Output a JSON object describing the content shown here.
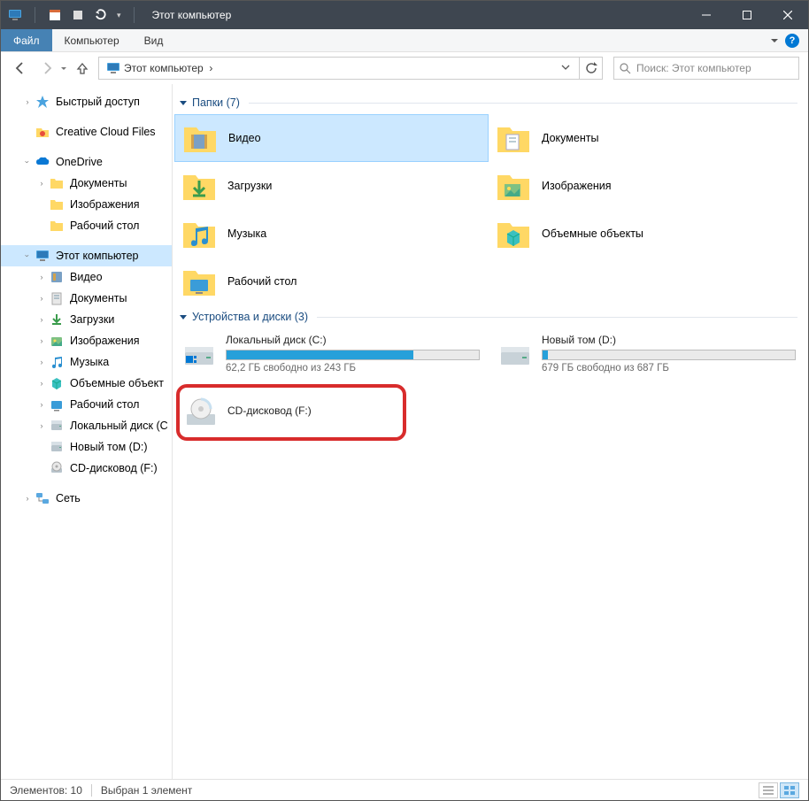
{
  "titlebar": {
    "title": "Этот компьютер"
  },
  "ribbon": {
    "file": "Файл",
    "tab1": "Компьютер",
    "tab2": "Вид"
  },
  "nav": {
    "breadcrumb": "Этот компьютер",
    "search_placeholder": "Поиск: Этот компьютер"
  },
  "sidebar": {
    "quick_access": "Быстрый доступ",
    "creative_cloud": "Creative Cloud Files",
    "onedrive": "OneDrive",
    "onedrive_children": [
      "Документы",
      "Изображения",
      "Рабочий стол"
    ],
    "this_pc": "Этот компьютер",
    "this_pc_children": [
      "Видео",
      "Документы",
      "Загрузки",
      "Изображения",
      "Музыка",
      "Объемные объект",
      "Рабочий стол",
      "Локальный диск (C",
      "Новый том (D:)",
      "CD-дисковод (F:)"
    ],
    "network": "Сеть"
  },
  "groups": {
    "folders": {
      "title": "Папки (7)"
    },
    "drives": {
      "title": "Устройства и диски (3)"
    }
  },
  "folders": [
    "Видео",
    "Документы",
    "Загрузки",
    "Изображения",
    "Музыка",
    "Объемные объекты",
    "Рабочий стол"
  ],
  "drives": {
    "c": {
      "name": "Локальный диск (C:)",
      "sub": "62,2 ГБ свободно из 243 ГБ",
      "fill_pct": 74
    },
    "d": {
      "name": "Новый том (D:)",
      "sub": "679 ГБ свободно из 687 ГБ",
      "fill_pct": 2
    },
    "f": {
      "name": "CD-дисковод (F:)"
    }
  },
  "status": {
    "items": "Элементов: 10",
    "selected": "Выбран 1 элемент"
  }
}
